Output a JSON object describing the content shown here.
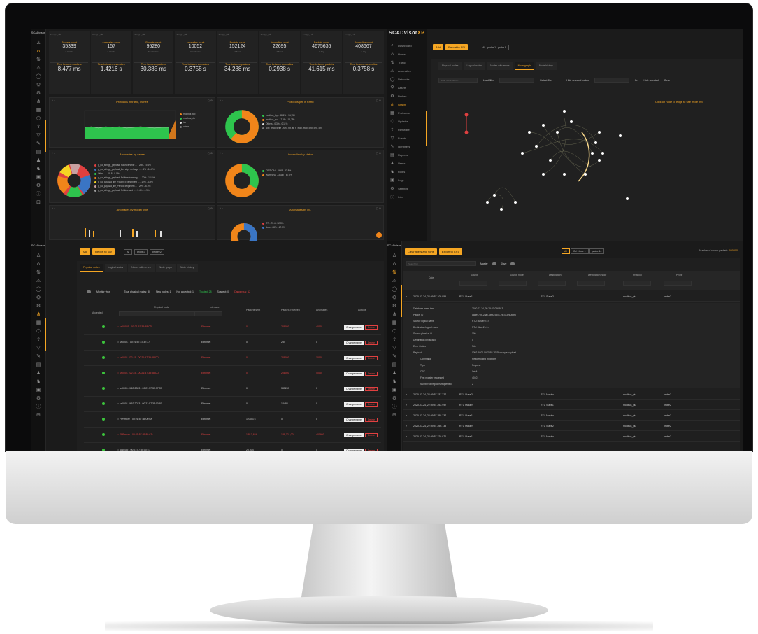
{
  "q1": {
    "brand": "SCADvisor",
    "card_toolbar": "+ ⌂  ◎  ▢ ⚙",
    "cards": [
      {
        "label": "Packets count",
        "value": "35339",
        "sub": "1 minute",
        "lbl2": "Time between packets",
        "val2": "8.477 ms"
      },
      {
        "label": "Anomalies count",
        "value": "157",
        "sub": "1 minute",
        "lbl2": "Time between anomalies",
        "val2": "1.4216 s"
      },
      {
        "label": "Packets count",
        "value": "95280",
        "sub": "10 minutes",
        "lbl2": "Time between packets",
        "val2": "30.385 ms"
      },
      {
        "label": "Anomalies count",
        "value": "10052",
        "sub": "10 minutes",
        "lbl2": "Time between anomalies",
        "val2": "0.3758 s"
      },
      {
        "label": "Packets count",
        "value": "152124",
        "sub": "1 hour",
        "lbl2": "Time between packets",
        "val2": "34.288 ms"
      },
      {
        "label": "Anomalies count",
        "value": "22695",
        "sub": "1 hour",
        "lbl2": "Time between anomalies",
        "val2": "0.2938 s"
      },
      {
        "label": "Packets count",
        "value": "4675636",
        "sub": "1 day",
        "lbl2": "Time between packets",
        "val2": "41.615 ms"
      },
      {
        "label": "Anomalies count",
        "value": "408667",
        "sub": "1 day",
        "lbl2": "Time between anomalies",
        "val2": "0.3758 s"
      }
    ],
    "panels": {
      "traffic_title": "Protocols in traffic, inches",
      "traffic_sub": "1 hour",
      "proto_title": "Protocols per in traffic",
      "proto_sub": "1 hour",
      "anom_type_title": "Anomalies by cause",
      "anom_type_sub": "1 hour",
      "anom_status_title": "Anomalies by status",
      "anom_status_sub": "1 hour",
      "anom_model_title": "Anomalies by model type",
      "anom_model_sub": "1 hour",
      "anom_ml_title": "Anomalies by ML",
      "anom_ml_sub": "1 hour"
    },
    "traffic_legend": [
      "modbus_tcp",
      "modbus_rtu",
      "iec",
      "others"
    ],
    "proto_legend": [
      "modbus_tcp - 38.6% - 14,759",
      "modbus_rtu - 17.5% - 14,759",
      "Others - 0.3% - 0.11%",
      "Avg_read_write - run - tpt, at_n_mdp, mdp, dnp, dnx, dnx"
    ],
    "cause_legend": [
      "p_no_strings_payload: Pair/overwrite ... - 2kb - 19.6%",
      "p_no_strings_payload_lite, sign < charge ... - 4% - 10.8%",
      "Other ... - 19.8 - 8.0%",
      "p_no_strings_payload: Pri/time is wrong ... - 20% - 12.8%",
      "p_no_payload_lite_Flowin. p_length est ... - 12% - 3.9%",
      "p_no_payload_lite_Period: length est ... - 20% - 6.5%",
      "p_no_strings_payload: Pri/time and ... - 3.4% - 4.9%"
    ],
    "status_legend": [
      "CRITICAL - 1645 - 32.8%",
      "WARNING - 3,347 - 67.2%"
    ],
    "ml_legend": [
      "iFF - 75.4 - 52.3%",
      "Auto - 68% - 47.7%"
    ]
  },
  "q2": {
    "brand": "SCADvisor",
    "brand_suffix": "XP",
    "add_btn": "Add",
    "report_btn": "Report to SIV",
    "chip": "All - probe 1 - probe 8",
    "nav": [
      {
        "icon": "⌕",
        "label": "Dashboard"
      },
      {
        "icon": "⌂",
        "label": "Home"
      },
      {
        "icon": "⇅",
        "label": "Traffic"
      },
      {
        "icon": "⚠",
        "label": "Anomalies"
      },
      {
        "icon": "◯",
        "label": "Networks"
      },
      {
        "icon": "⛭",
        "label": "Assets"
      },
      {
        "icon": "⚙",
        "label": "Probes"
      },
      {
        "icon": "⋔",
        "label": "Graph"
      },
      {
        "icon": "▦",
        "label": "Protocols"
      },
      {
        "icon": "⬡",
        "label": "Updates"
      },
      {
        "icon": "⇪",
        "label": "Firmware"
      },
      {
        "icon": "▽",
        "label": "Events"
      },
      {
        "icon": "✎",
        "label": "Identifiers"
      },
      {
        "icon": "▤",
        "label": "Reports"
      },
      {
        "icon": "♟",
        "label": "Users"
      },
      {
        "icon": "♞",
        "label": "Roles"
      },
      {
        "icon": "▣",
        "label": "Logs"
      },
      {
        "icon": "⚙",
        "label": "Settings"
      },
      {
        "icon": "ⓘ",
        "label": "Info"
      }
    ],
    "tabs": [
      "Physical nodes",
      "Logical nodes",
      "Nodes with errors",
      "Node graph",
      "Node history"
    ],
    "active_tab": 3,
    "filter_placeholder": "Node name search",
    "highlight": "Load filter",
    "detect_label": "Detect filter",
    "hide_label": "Hide selected nodes",
    "on_label": "On",
    "hide_all": "Hide selected",
    "clear": "Clear",
    "hint": "Click on node or edge to see more info"
  },
  "q3": {
    "brand": "SCADvisor",
    "add_btn": "Add",
    "report_btn": "Report to SIV",
    "chips": [
      "All",
      "probe1",
      "probe22"
    ],
    "tabs": [
      "Physical nodes",
      "Logical nodes",
      "Nodes with errors",
      "Node graph",
      "Node history"
    ],
    "summary": {
      "toggle": "Monitor view",
      "total": "Total physical nodes: 30",
      "new": "New nodes: 1",
      "not_accepted": "Not accepted: 1",
      "trusted": "Trusted: 28",
      "suspect": "Suspect: 0",
      "dangerous": "Dangerous: 12"
    },
    "headers": [
      "Accepted",
      "Physical node",
      "Interface",
      "Packets sent",
      "Packets received",
      "Anomalies",
      "Actions"
    ],
    "rows": [
      {
        "node": "○ sr 05001 - 00:21:57:35:88:CD",
        "iface": "Ethernet",
        "sent": "0",
        "recv": "208000",
        "anom": "4000",
        "red": true
      },
      {
        "node": "○ sr 0001 - 00:21:57:37:37:37",
        "iface": "Ethernet",
        "sent": "0",
        "recv": "284",
        "anom": "0",
        "red": false
      },
      {
        "node": "○ sr 0001 222.45 - 00:21:57:35:88:CD",
        "iface": "Ethernet",
        "sent": "0",
        "recv": "208000",
        "anom": "1000",
        "red": true
      },
      {
        "node": "○ sr 0001 222.45 - 00:21:57:35:88:CD",
        "iface": "Ethernet",
        "sent": "0",
        "recv": "208000",
        "anom": "4000",
        "red": true
      },
      {
        "node": "○ sr 0001.2463.2023 - 00:21:57:37:37:37",
        "iface": "Ethernet",
        "sent": "0",
        "recv": "385249",
        "anom": "0",
        "red": false
      },
      {
        "node": "○ sr 0001.2463.2023 - 00:21:57:35:00:97",
        "iface": "Ethernet",
        "sent": "0",
        "recv": "12488",
        "anom": "0",
        "red": false
      },
      {
        "node": "○ FPPmore - 00:21:57:35:00:0A",
        "iface": "Ethernet",
        "sent": "1230474",
        "recv": "0",
        "anom": "0",
        "red": false
      },
      {
        "node": "○ FPPmore - 00:21:57:35:88:CD",
        "iface": "Ethernet",
        "sent": "1,817,624",
        "recv": "188,721,024",
        "anom": "401900",
        "red": true
      },
      {
        "node": "○ ABB4cc - 00:21:57:35:00:E3",
        "iface": "Ethernet",
        "sent": "20,004",
        "recv": "0",
        "anom": "0",
        "red": false
      }
    ],
    "change_btn": "Change name",
    "delete_btn": "Delete"
  },
  "q4": {
    "clear_btn": "Clear filters and sorts",
    "report_btn": "Export to CSV",
    "chips": [
      "All",
      "Ctrl Node 1",
      "probe 14"
    ],
    "count_label": "Number of shown packets:",
    "count_value": "1000000",
    "search_placeholder": "Search for",
    "master_label": "Master",
    "slave_label": "Slave",
    "headers": [
      "Date",
      "Source",
      "Source node",
      "Destination",
      "Destination node",
      "Protocol",
      "Probe"
    ],
    "rows": [
      {
        "date": "2020-07-24, 22:59:57.105.855",
        "src": "RTU Slave1",
        "dst": "RTU Slave2",
        "proto": "modbus_rtu",
        "probe": "probe2"
      },
      {
        "date": "2020-07-24, 22:59:57.237.227",
        "src": "RTU Slave2",
        "dst": "RTU Master",
        "proto": "modbus_rtu",
        "probe": "probe2"
      },
      {
        "date": "2020-07-24, 22:59:57.252.992",
        "src": "RTU Master",
        "dst": "RTU Slave1",
        "proto": "modbus_rtu",
        "probe": "probe2"
      },
      {
        "date": "2020-07-24, 22:59:57.258.237",
        "src": "RTU Slave1",
        "dst": "RTU Master",
        "proto": "modbus_rtu",
        "probe": "probe2"
      },
      {
        "date": "2020-07-24, 22:59:57.256.738",
        "src": "RTU Master",
        "dst": "RTU Slave2",
        "proto": "modbus_rtu",
        "probe": "probe2"
      },
      {
        "date": "2020-07-24, 22:59:57.276.070",
        "src": "RTU Slave1",
        "dst": "RTU Master",
        "proto": "modbus_rtu",
        "probe": "probe2"
      }
    ],
    "details": [
      [
        "Database insert time",
        "2020-07-24, 08:25:47.056.913"
      ],
      [
        "Packet ID",
        "a8de9795-28ac-4b60-9801-ef87a3e60d9f5"
      ],
      [
        "Source logical name",
        "RTU Master <1>"
      ],
      [
        "Destination logical name",
        "RTU Slave2 <1>"
      ],
      [
        "Source physical id",
        "100"
      ],
      [
        "Destination physical id",
        "0"
      ],
      [
        "Error Codes",
        "N/A"
      ],
      [
        "Payload",
        "0302 4C00 0A 7B52 7F      Show byte payload"
      ],
      [
        "Command",
        "Read Holding Registers"
      ],
      [
        "Type",
        "Request"
      ],
      [
        "CRC",
        "0x0A"
      ],
      [
        "First register requested",
        "40101"
      ],
      [
        "Number of registers requested",
        "2"
      ]
    ]
  },
  "colors": {
    "accent": "#f5a623",
    "green": "#2ec44d",
    "orange": "#f0851a",
    "red": "#e04040",
    "blue": "#3a75c4"
  }
}
